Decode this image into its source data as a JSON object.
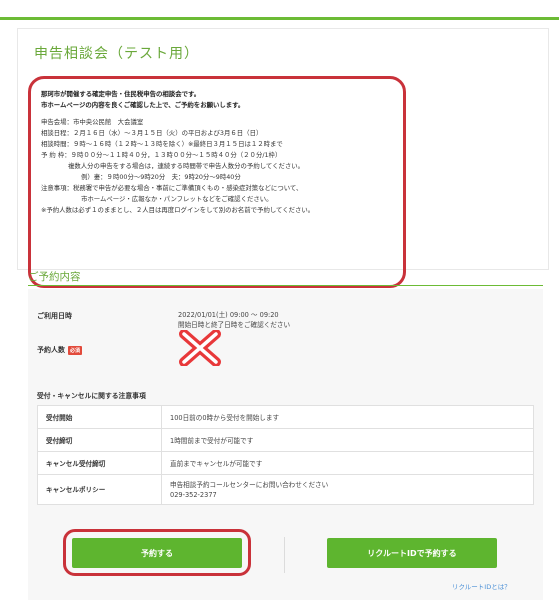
{
  "page": {
    "title": "申告相談会（テスト用）"
  },
  "notice": {
    "intro1": "那珂市が開催する確定申告・住民税申告の相談会です。",
    "intro2": "市ホームページの内容を良くご確認した上で、ご予約をお願いします。",
    "venue": "申告会場：市中央公民館　大会議室",
    "dates": "相談日程：２月１６日（水）～３月１５日（火）の平日および3月６日（日）",
    "hours": "相談時間：９時～１６時（１２時～１３時を除く）※最終日３月１５日は１２時まで",
    "slots": "予 約 枠：９時００分～１１時４０分，１３時００分～１５時４０分（２０分/1枠）",
    "multi1": "複数人分の申告をする場合は，連続する時間帯で申告人数分の予約してください。",
    "multi2": "例）妻：９時00分～9時20分　夫：9時20分～9時40分",
    "caution1": "注意事項：税務署で申告が必要な場合・事前にご準備頂くもの・感染症対策などについて、",
    "caution2": "市ホームページ・広報なか・パンフレットなどをご確認ください。",
    "caution3": "※予約人数は必ず１のままとし、２人目は再度ログインをして別のお名前で予約してください。"
  },
  "reservation": {
    "section_title": "ご予約内容",
    "datetime_label": "ご利用日時",
    "datetime_value": "2022/01/01(土) 09:00 ～ 09:20",
    "datetime_note": "開始日時と終了日時をご確認ください",
    "people_label": "予約人数",
    "required_badge": "必須"
  },
  "rules": {
    "title": "受付・キャンセルに関する注意事項",
    "rows": [
      {
        "key": "受付開始",
        "value": "100日前の0時から受付を開始します"
      },
      {
        "key": "受付締切",
        "value": "1時間前まで受付が可能です"
      },
      {
        "key": "キャンセル受付締切",
        "value": "直前までキャンセルが可能です"
      },
      {
        "key": "キャンセルポリシー",
        "value": "申告相談予約コールセンターにお問い合わせください",
        "value2": "029-352-2377"
      }
    ]
  },
  "actions": {
    "reserve_label": "予約する",
    "recruit_label": "リクルートIDで予約する",
    "recruit_help": "リクルートIDとは？"
  },
  "colors": {
    "accent_green": "#6cbb35",
    "button_green": "#5eb52f",
    "highlight_red": "#c9323a",
    "link_blue": "#4a8fd6"
  }
}
